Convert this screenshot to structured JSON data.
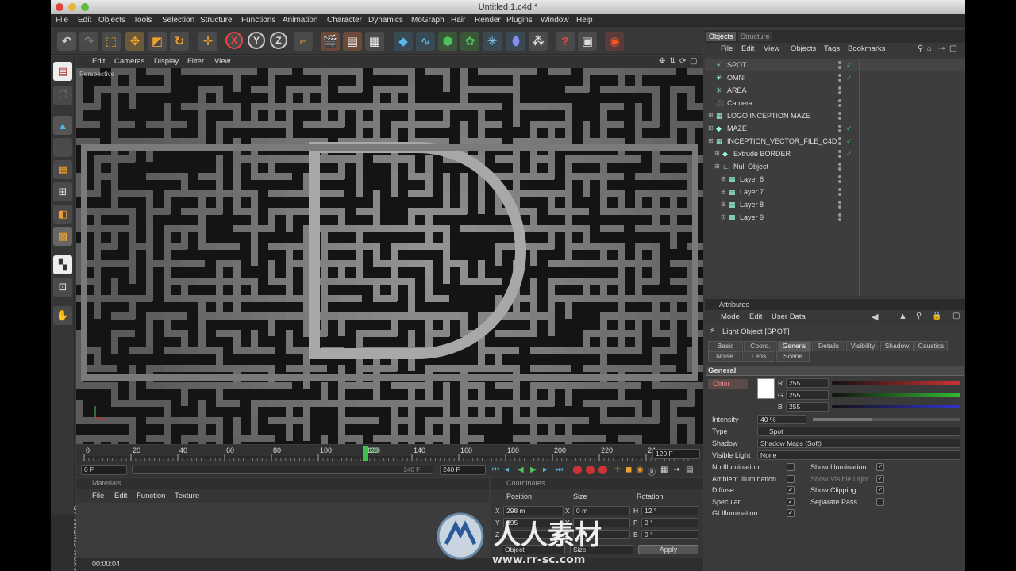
{
  "window": {
    "title": "Untitled 1.c4d *"
  },
  "menu": [
    "File",
    "Edit",
    "Objects",
    "Tools",
    "Selection",
    "Structure",
    "Functions",
    "Animation",
    "Character",
    "Dynamics",
    "MoGraph",
    "Hair",
    "Render",
    "Plugins",
    "Window",
    "Help"
  ],
  "viewport": {
    "menu": [
      "Edit",
      "Cameras",
      "Display",
      "Filter",
      "View"
    ],
    "label": "Perspective"
  },
  "timeline": {
    "ticks": [
      "0",
      "20",
      "40",
      "60",
      "80",
      "100",
      "120",
      "140",
      "160",
      "180",
      "200",
      "220",
      "24"
    ],
    "current_frame": "120",
    "end_field": "120 F",
    "start": "0 F",
    "range_end_a": "240 F",
    "range_end_b": "240 F"
  },
  "materials": {
    "title": "Materials",
    "menu": [
      "File",
      "Edit",
      "Function",
      "Texture"
    ]
  },
  "coordinates": {
    "title": "Coordinates",
    "columns": [
      "Position",
      "Size",
      "Rotation"
    ],
    "rows": [
      {
        "axis": "X",
        "pos": "298 m",
        "size_axis": "X",
        "size": "0 m",
        "rot_axis": "H",
        "rot": "12 °"
      },
      {
        "axis": "Y",
        "pos": "395",
        "size_axis": "Y",
        "size": "",
        "rot_axis": "P",
        "rot": "0 °"
      },
      {
        "axis": "Z",
        "pos": "-1",
        "size_axis": "Z",
        "size": "",
        "rot_axis": "B",
        "rot": "0 °"
      }
    ],
    "mode_a": "Object",
    "mode_b": "Size",
    "apply": "Apply"
  },
  "status": {
    "time": "00:00:04"
  },
  "brand": "MAXON CINEMA 4D",
  "objects_panel": {
    "tabs": [
      "Objects",
      "Structure"
    ],
    "menu": [
      "File",
      "Edit",
      "View",
      "Objects",
      "Tags",
      "Bookmarks"
    ],
    "items": [
      {
        "name": "SPOT",
        "indent": 0,
        "check": true
      },
      {
        "name": "OMNI",
        "indent": 0,
        "check": true
      },
      {
        "name": "AREA",
        "indent": 0,
        "check": false
      },
      {
        "name": "Camera",
        "indent": 0,
        "check": false
      },
      {
        "name": "LOGO INCEPTION MAZE",
        "indent": 0,
        "check": false
      },
      {
        "name": "MAZE",
        "indent": 0,
        "check": true
      },
      {
        "name": "INCEPTION_VECTOR_FILE_C4D",
        "indent": 0,
        "check": true
      },
      {
        "name": "Extrude BORDER",
        "indent": 1,
        "check": true
      },
      {
        "name": "Null Object",
        "indent": 1,
        "check": false
      },
      {
        "name": "Layer 6",
        "indent": 2,
        "check": false
      },
      {
        "name": "Layer 7",
        "indent": 2,
        "check": false
      },
      {
        "name": "Layer 8",
        "indent": 2,
        "check": false
      },
      {
        "name": "Layer 9",
        "indent": 2,
        "check": false
      }
    ]
  },
  "attributes": {
    "title": "Attributes",
    "menu": [
      "Mode",
      "Edit",
      "User Data"
    ],
    "object": "Light Object [SPOT]",
    "tabs_row1": [
      "Basic",
      "Coord.",
      "General",
      "Details",
      "Visibility",
      "Shadow",
      "Caustics"
    ],
    "tabs_row2": [
      "Noise",
      "Lens",
      "Scene"
    ],
    "active_tab": "General",
    "section": "General",
    "color_label": "Color",
    "rgb": [
      {
        "ch": "R",
        "val": "255"
      },
      {
        "ch": "G",
        "val": "255"
      },
      {
        "ch": "B",
        "val": "255"
      }
    ],
    "intensity_label": "Intensity",
    "intensity": "40 %",
    "intensity_fraction": 0.4,
    "type_label": "Type",
    "type": "Spot",
    "shadow_label": "Shadow",
    "shadow": "Shadow Maps (Soft)",
    "visible_light_label": "Visible Light",
    "visible_light": "None",
    "checks_left": [
      {
        "label": "No Illumination",
        "checked": false
      },
      {
        "label": "Ambient Illumination",
        "checked": false
      },
      {
        "label": "Diffuse",
        "checked": true
      },
      {
        "label": "Specular",
        "checked": true
      },
      {
        "label": "GI Illumination",
        "checked": true
      }
    ],
    "checks_right": [
      {
        "label": "Show Illumination",
        "checked": true
      },
      {
        "label": "Show Visible Light",
        "checked": true
      },
      {
        "label": "Show Clipping",
        "checked": true
      },
      {
        "label": "Separate Pass",
        "checked": false
      }
    ]
  },
  "watermark": {
    "text": "人人素材",
    "url": "www.rr-sc.com"
  },
  "colors": {
    "accent_orange": "#d9722a",
    "panel": "#3a3a3a",
    "dark": "#2b2b2b",
    "green_frame": "#3ec24a"
  }
}
